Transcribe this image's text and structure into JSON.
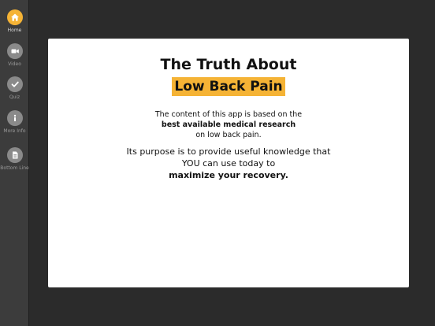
{
  "sidebar": {
    "items": [
      {
        "label": "Home",
        "icon": "home-icon",
        "active": true
      },
      {
        "label": "Video",
        "icon": "video-icon",
        "active": false
      },
      {
        "label": "Quiz",
        "icon": "check-icon",
        "active": false
      },
      {
        "label": "More Info",
        "icon": "info-icon",
        "active": false
      },
      {
        "label": "Bottom Line",
        "icon": "document-icon",
        "active": false
      }
    ]
  },
  "card": {
    "title": "The Truth About",
    "subtitle": "Low Back Pain",
    "para1": {
      "line1": "The content of this app is based on the",
      "line2": "best available medical research",
      "line3": "on low back pain."
    },
    "para2": {
      "line1": "Its purpose is to provide useful knowledge that",
      "line2": "YOU can use today to",
      "line3": "maximize your recovery."
    }
  },
  "colors": {
    "accent": "#f5b335",
    "sidebar_bg": "#3c3c3c",
    "page_bg": "#2b2b2b",
    "card_bg": "#ffffff"
  }
}
